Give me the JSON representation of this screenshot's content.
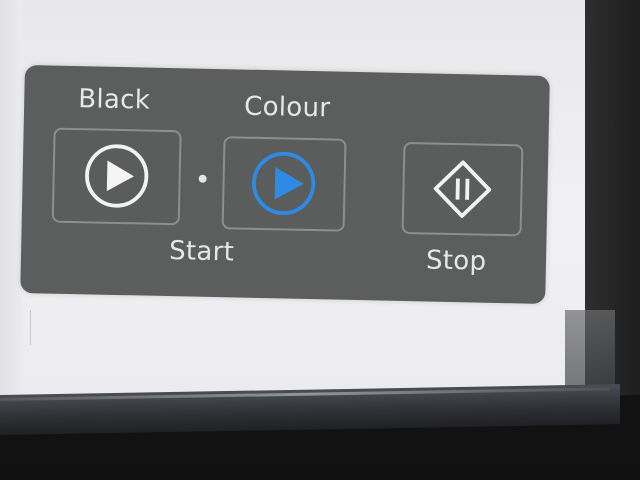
{
  "panel": {
    "labels": {
      "black": "Black",
      "colour": "Colour",
      "start": "Start",
      "stop": "Stop"
    },
    "colors": {
      "panel_bg": "#5b5e5d",
      "label_text": "#e6e8e7",
      "colour_accent": "#2f8ae6"
    },
    "buttons": {
      "black_start": {
        "icon": "play-icon"
      },
      "colour_start": {
        "icon": "play-icon"
      },
      "stop": {
        "icon": "stop-diamond-icon"
      }
    }
  }
}
